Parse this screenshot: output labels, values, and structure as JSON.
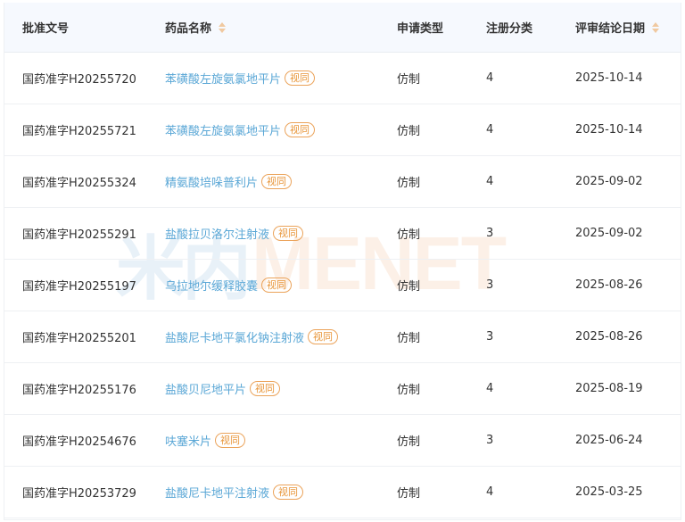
{
  "headers": {
    "approval_no": "批准文号",
    "drug_name": "药品名称",
    "application_type": "申请类型",
    "registration_class": "注册分类",
    "review_date": "评审结论日期"
  },
  "badge_label": "视同",
  "watermark": {
    "logo": "米内",
    "text": "MENET"
  },
  "rows": [
    {
      "approval_no": "国药准字H20255720",
      "drug_name": "苯磺酸左旋氨氯地平片",
      "application_type": "仿制",
      "registration_class": "4",
      "review_date": "2025-10-14"
    },
    {
      "approval_no": "国药准字H20255721",
      "drug_name": "苯磺酸左旋氨氯地平片",
      "application_type": "仿制",
      "registration_class": "4",
      "review_date": "2025-10-14"
    },
    {
      "approval_no": "国药准字H20255324",
      "drug_name": "精氨酸培哚普利片",
      "application_type": "仿制",
      "registration_class": "4",
      "review_date": "2025-09-02"
    },
    {
      "approval_no": "国药准字H20255291",
      "drug_name": "盐酸拉贝洛尔注射液",
      "application_type": "仿制",
      "registration_class": "3",
      "review_date": "2025-09-02"
    },
    {
      "approval_no": "国药准字H20255197",
      "drug_name": "乌拉地尔缓释胶囊",
      "application_type": "仿制",
      "registration_class": "3",
      "review_date": "2025-08-26"
    },
    {
      "approval_no": "国药准字H20255201",
      "drug_name": "盐酸尼卡地平氯化钠注射液",
      "application_type": "仿制",
      "registration_class": "3",
      "review_date": "2025-08-26"
    },
    {
      "approval_no": "国药准字H20255176",
      "drug_name": "盐酸贝尼地平片",
      "application_type": "仿制",
      "registration_class": "4",
      "review_date": "2025-08-19"
    },
    {
      "approval_no": "国药准字H20254676",
      "drug_name": "呋塞米片",
      "application_type": "仿制",
      "registration_class": "3",
      "review_date": "2025-06-24"
    },
    {
      "approval_no": "国药准字H20253729",
      "drug_name": "盐酸尼卡地平注射液",
      "application_type": "仿制",
      "registration_class": "4",
      "review_date": "2025-03-25"
    }
  ],
  "colors": {
    "link": "#5aa7d6",
    "badge": "#e8963a",
    "header_bg": "#f6f9fe"
  }
}
